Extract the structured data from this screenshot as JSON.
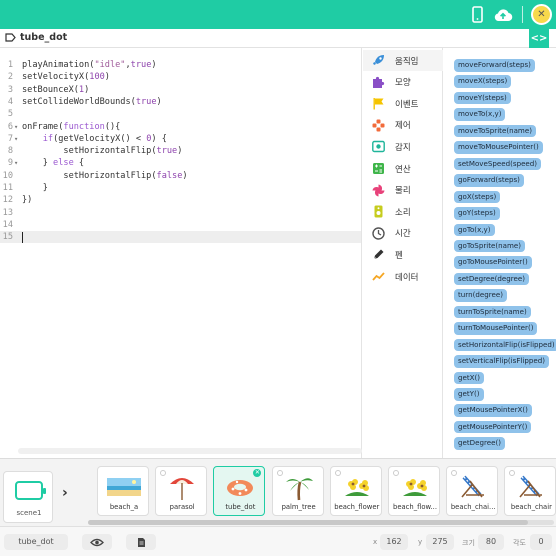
{
  "theme": {
    "accent": "#1fcca4",
    "block_color": "#8fc2ea"
  },
  "topbar": {
    "icons": [
      "mobile-preview-icon",
      "cloud-upload-icon",
      "settings-avatar-icon"
    ]
  },
  "file": {
    "name": "tube_dot",
    "panel_toggle": "<>"
  },
  "editor": {
    "lines": [
      {
        "n": "1",
        "fold": "",
        "code": "playAnimation(\"idle\",true)"
      },
      {
        "n": "2",
        "fold": "",
        "code": "setVelocityX(100)"
      },
      {
        "n": "3",
        "fold": "",
        "code": "setBounceX(1)"
      },
      {
        "n": "4",
        "fold": "",
        "code": "setCollideWorldBounds(true)"
      },
      {
        "n": "5",
        "fold": "",
        "code": ""
      },
      {
        "n": "6",
        "fold": "▾",
        "code": "onFrame(function(){"
      },
      {
        "n": "7",
        "fold": "▾",
        "code": "    if(getVelocityX() < 0) {"
      },
      {
        "n": "8",
        "fold": "",
        "code": "        setHorizontalFlip(true)"
      },
      {
        "n": "9",
        "fold": "▾",
        "code": "    } else {"
      },
      {
        "n": "10",
        "fold": "",
        "code": "        setHorizontalFlip(false)"
      },
      {
        "n": "11",
        "fold": "",
        "code": "    }"
      },
      {
        "n": "12",
        "fold": "",
        "code": "})"
      },
      {
        "n": "13",
        "fold": "",
        "code": ""
      },
      {
        "n": "14",
        "fold": "",
        "code": ""
      },
      {
        "n": "15",
        "fold": "",
        "code": ""
      }
    ],
    "active_line": 15
  },
  "categories": [
    {
      "label": "움직임",
      "icon": "rocket-icon",
      "color": "#3a8fd8"
    },
    {
      "label": "모양",
      "icon": "puzzle-icon",
      "color": "#8a4fc6"
    },
    {
      "label": "이벤트",
      "icon": "flag-icon",
      "color": "#f5c400"
    },
    {
      "label": "제어",
      "icon": "control-cross-icon",
      "color": "#f26b3a"
    },
    {
      "label": "감지",
      "icon": "sensor-icon",
      "color": "#1fb59a"
    },
    {
      "label": "연산",
      "icon": "calculator-icon",
      "color": "#3fb54a"
    },
    {
      "label": "물리",
      "icon": "pinwheel-icon",
      "color": "#e8427a"
    },
    {
      "label": "소리",
      "icon": "speaker-icon",
      "color": "#c6cc1e"
    },
    {
      "label": "시간",
      "icon": "clock-icon",
      "color": "#555555"
    },
    {
      "label": "펜",
      "icon": "pen-icon",
      "color": "#333333"
    },
    {
      "label": "데이터",
      "icon": "chart-line-icon",
      "color": "#f5a623"
    }
  ],
  "blocks": [
    "moveForward(steps)",
    "moveX(steps)",
    "moveY(steps)",
    "moveTo(x,y)",
    "moveToSprite(name)",
    "moveToMousePointer()",
    "setMoveSpeed(speed)",
    "goForward(steps)",
    "goX(steps)",
    "goY(steps)",
    "goTo(x,y)",
    "goToSprite(name)",
    "goToMousePointer()",
    "setDegree(degree)",
    "turn(degree)",
    "turnToSprite(name)",
    "turnToMousePointer()",
    "setHorizontalFlip(isFlipped)",
    "setVerticalFlip(isFlipped)",
    "getX()",
    "getY()",
    "getMousePointerX()",
    "getMousePointerY()",
    "getDegree()"
  ],
  "scene": {
    "label": "scene1"
  },
  "sprites": [
    {
      "name": "beach_a",
      "icon": "beach-scene-icon"
    },
    {
      "name": "parasol",
      "icon": "parasol-icon"
    },
    {
      "name": "tube_dot",
      "icon": "swim-tube-icon"
    },
    {
      "name": "palm_tree",
      "icon": "palm-tree-icon"
    },
    {
      "name": "beach_flower",
      "icon": "flower-icon"
    },
    {
      "name": "beach_flow...",
      "icon": "flower-icon"
    },
    {
      "name": "beach_chai...",
      "icon": "beach-chair-icon"
    },
    {
      "name": "beach_chair",
      "icon": "beach-chair-icon"
    }
  ],
  "selected_sprite": "tube_dot",
  "bottombar": {
    "object_name": "tube_dot",
    "x_label": "x",
    "x_value": "162",
    "y_label": "y",
    "y_value": "275",
    "size_label": "크기",
    "size_value": "80",
    "angle_label": "각도",
    "angle_value": "0"
  }
}
